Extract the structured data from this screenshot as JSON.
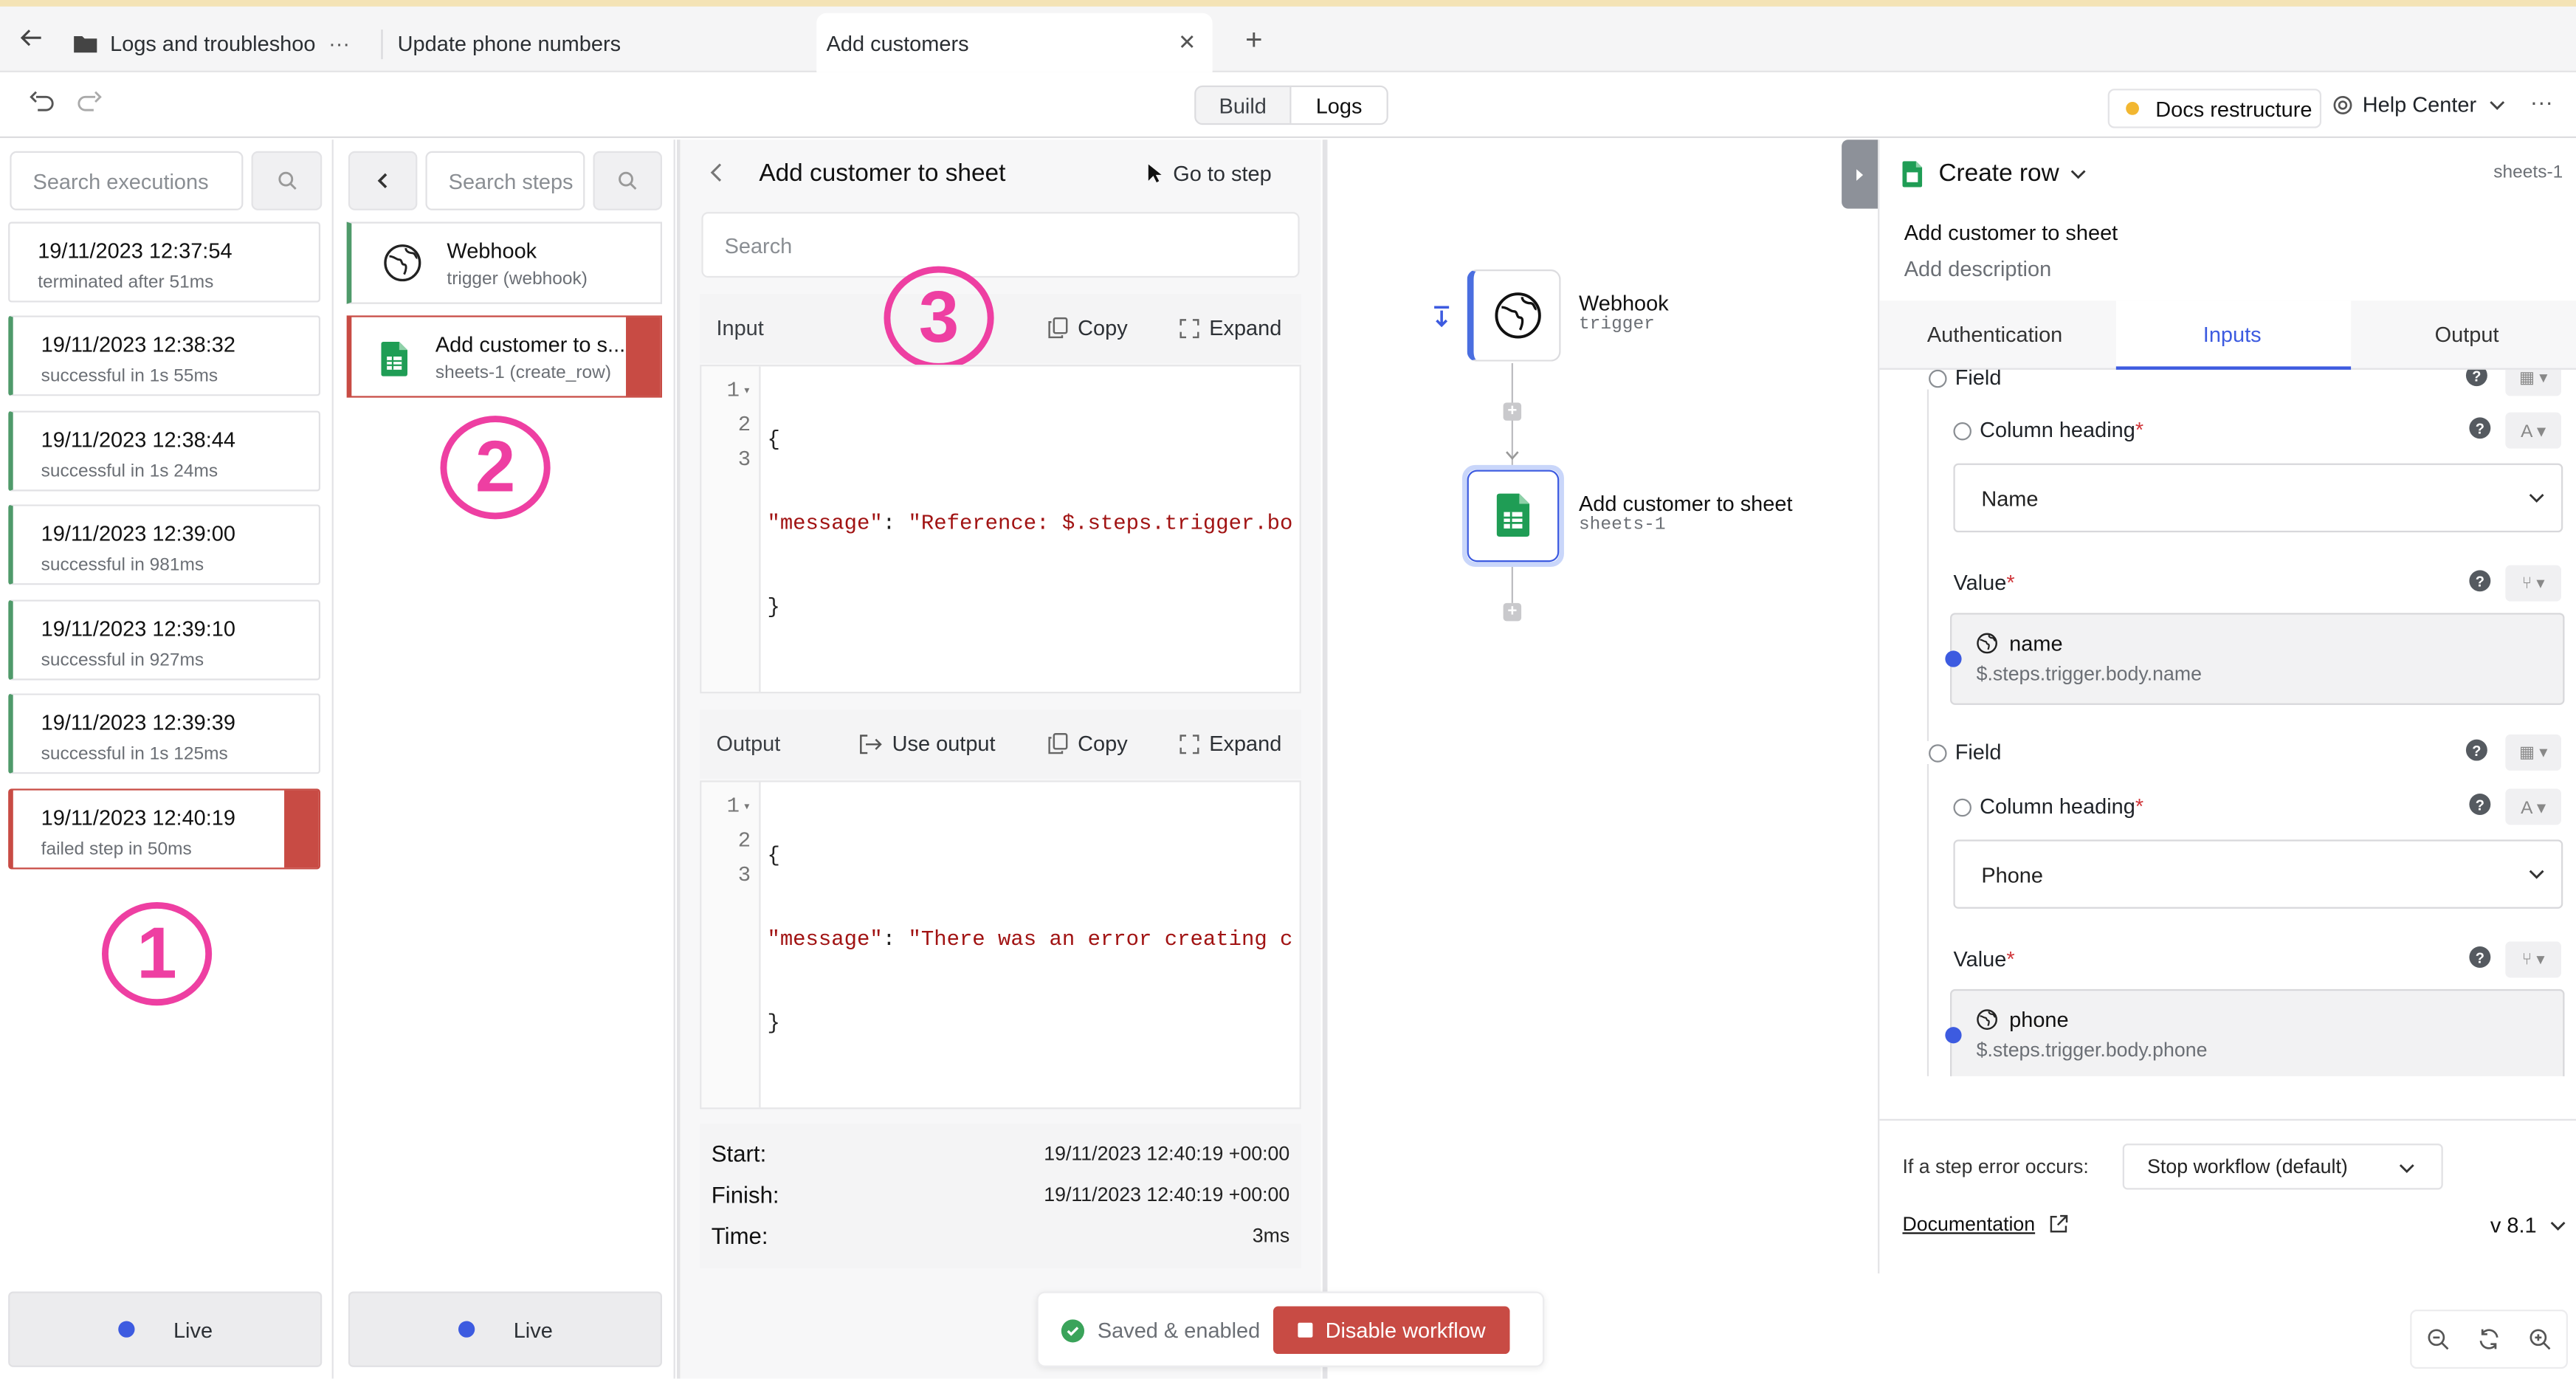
{
  "tabs": {
    "tab1": "Logs and troubleshoo",
    "tab2": "Update phone numbers",
    "tab3": "Add customers",
    "more": "···",
    "close": "✕",
    "add": "+"
  },
  "toolbar": {
    "build": "Build",
    "logs": "Logs",
    "workspace": "Docs restructure",
    "help": "Help Center",
    "more": "···"
  },
  "executions": {
    "search_placeholder": "Search executions",
    "items": [
      {
        "time": "19/11/2023 12:37:54",
        "status": "terminated after 51ms"
      },
      {
        "time": "19/11/2023 12:38:32",
        "status": "successful in 1s 55ms"
      },
      {
        "time": "19/11/2023 12:38:44",
        "status": "successful in 1s 24ms"
      },
      {
        "time": "19/11/2023 12:39:00",
        "status": "successful in 981ms"
      },
      {
        "time": "19/11/2023 12:39:10",
        "status": "successful in 927ms"
      },
      {
        "time": "19/11/2023 12:39:39",
        "status": "successful in 1s 125ms"
      },
      {
        "time": "19/11/2023 12:40:19",
        "status": "failed step in 50ms"
      }
    ],
    "live": "Live",
    "badge": "1"
  },
  "steps": {
    "search_placeholder": "Search steps",
    "back": "‹",
    "items": [
      {
        "name": "Webhook",
        "sub": "trigger (webhook)"
      },
      {
        "name": "Add customer to s...",
        "sub": "sheets-1 (create_row)"
      }
    ],
    "live": "Live",
    "badge": "2"
  },
  "detail": {
    "title": "Add customer to sheet",
    "go_to_step": "Go to step",
    "search_placeholder": "Search",
    "badge": "3",
    "input": {
      "label": "Input",
      "copy": "Copy",
      "expand": "Expand",
      "lines": [
        "1",
        "2",
        "3"
      ],
      "brace_open": "{",
      "key": "\"message\"",
      "colon": ": ",
      "value": "\"Reference: $.steps.trigger.bo",
      "brace_close": "}"
    },
    "output": {
      "label": "Output",
      "use_output": "Use output",
      "copy": "Copy",
      "expand": "Expand",
      "lines": [
        "1",
        "2",
        "3"
      ],
      "brace_open": "{",
      "key": "\"message\"",
      "colon": ": ",
      "value": "\"There was an error creating c",
      "brace_close": "}"
    },
    "timing": {
      "start_label": "Start:",
      "start": "19/11/2023 12:40:19 +00:00",
      "finish_label": "Finish:",
      "finish": "19/11/2023 12:40:19 +00:00",
      "time_label": "Time:",
      "time": "3ms"
    }
  },
  "canvas": {
    "node1": {
      "title": "Webhook",
      "sub": "trigger"
    },
    "node2": {
      "title": "Add customer to sheet",
      "sub": "sheets-1"
    },
    "saved": "Saved & enabled",
    "disable": "Disable workflow"
  },
  "config": {
    "title": "Create row",
    "id": "sheets-1",
    "name": "Add customer to sheet",
    "description": "Add description",
    "tabs": [
      "Authentication",
      "Inputs",
      "Output"
    ],
    "field_label": "Field",
    "column_heading_label": "Column heading",
    "value_label": "Value",
    "required_mark": "*",
    "fields": [
      {
        "column": "Name",
        "value_name": "name",
        "value_path": "$.steps.trigger.body.name"
      },
      {
        "column": "Phone",
        "value_name": "phone",
        "value_path": "$.steps.trigger.body.phone"
      }
    ],
    "error_label": "If a step error occurs:",
    "error_option": "Stop workflow (default)",
    "docs": "Documentation",
    "version": "v 8.1"
  }
}
